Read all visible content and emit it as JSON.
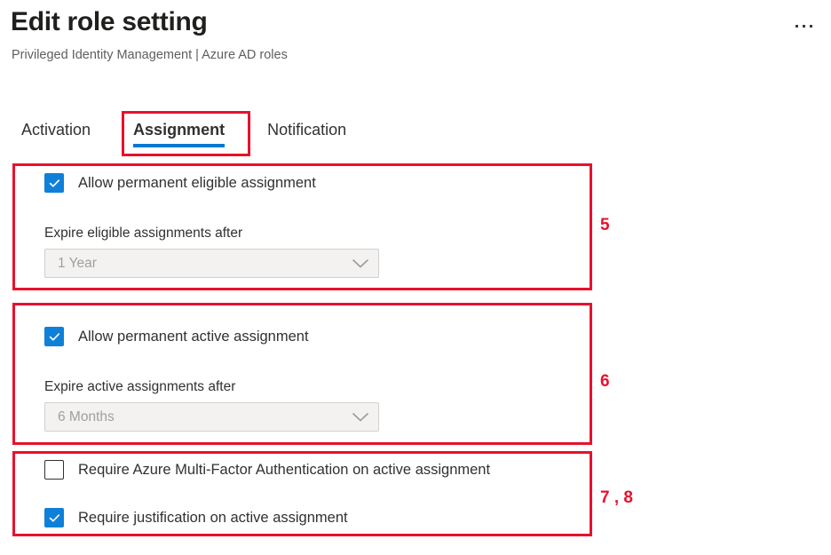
{
  "header": {
    "title": "Edit role setting",
    "subtitle": "Privileged Identity Management | Azure AD roles",
    "overflow_icon": "ellipsis-icon"
  },
  "tabs": [
    {
      "label": "Activation",
      "selected": false
    },
    {
      "label": "Assignment",
      "selected": true
    },
    {
      "label": "Notification",
      "selected": false
    }
  ],
  "groups": [
    {
      "annotation": "5",
      "checkbox": {
        "label": "Allow permanent eligible assignment",
        "checked": true,
        "icon": "checkmark-icon"
      },
      "field": {
        "label": "Expire eligible assignments after",
        "value": "1 Year",
        "disabled": true,
        "icon": "chevron-down-icon"
      }
    },
    {
      "annotation": "6",
      "checkbox": {
        "label": "Allow permanent active assignment",
        "checked": true,
        "icon": "checkmark-icon"
      },
      "field": {
        "label": "Expire active assignments after",
        "value": "6 Months",
        "disabled": true,
        "icon": "chevron-down-icon"
      }
    },
    {
      "annotation": "7 , 8",
      "checkboxes": [
        {
          "label": "Require Azure Multi-Factor Authentication on active assignment",
          "checked": false
        },
        {
          "label": "Require justification on active assignment",
          "checked": true,
          "icon": "checkmark-icon"
        }
      ]
    }
  ],
  "colors": {
    "accent_blue": "#0078d4",
    "checkbox_blue": "#0f80d8",
    "annotation_red": "#e8112d",
    "text_primary": "#323130",
    "text_secondary": "#605e5c",
    "disabled_text": "#a19f9d",
    "disabled_fill": "#f3f2f1"
  }
}
